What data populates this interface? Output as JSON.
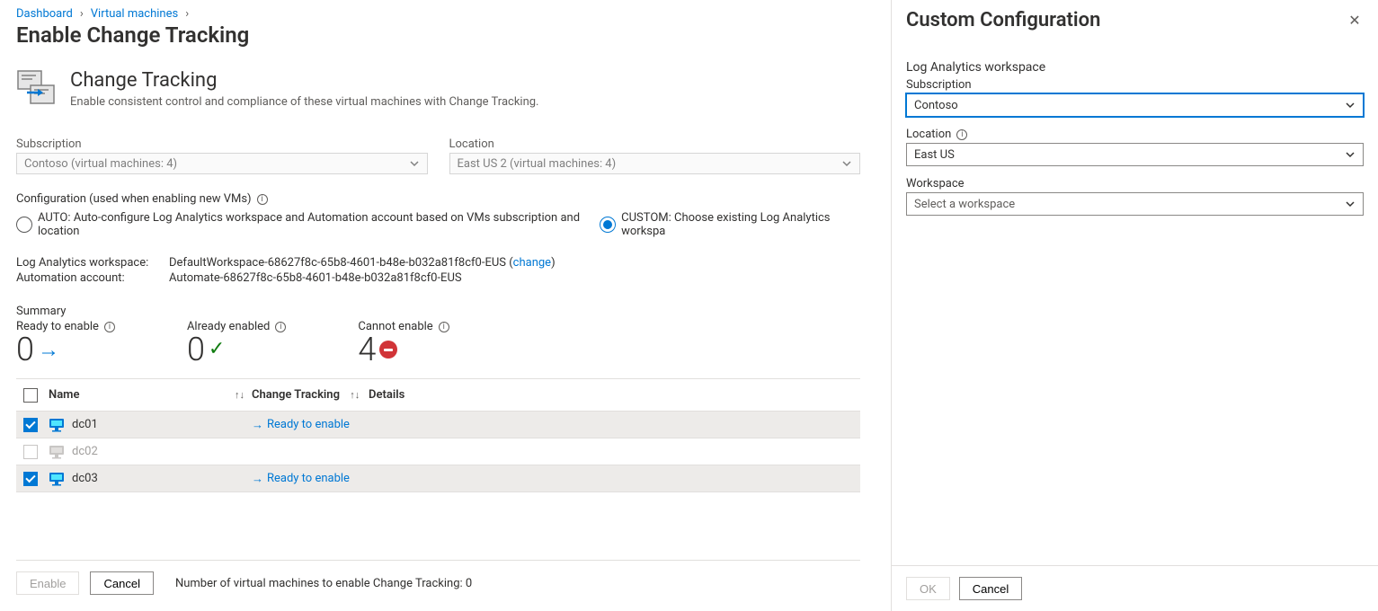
{
  "breadcrumb": {
    "dashboard": "Dashboard",
    "vms": "Virtual machines"
  },
  "page": {
    "title": "Enable Change Tracking"
  },
  "feature": {
    "title": "Change Tracking",
    "desc": "Enable consistent control and compliance of these virtual machines with Change Tracking."
  },
  "filters": {
    "subscription_label": "Subscription",
    "subscription_value": "Contoso (virtual machines: 4)",
    "location_label": "Location",
    "location_value": "East US 2 (virtual machines: 4)"
  },
  "config": {
    "header": "Configuration (used when enabling new VMs)",
    "auto": "AUTO: Auto-configure Log Analytics workspace and Automation account based on VMs subscription and location",
    "custom": "CUSTOM: Choose existing Log Analytics workspa",
    "workspace_label": "Log Analytics workspace:",
    "workspace_value": "DefaultWorkspace-68627f8c-65b8-4601-b48e-b032a81f8cf0-EUS",
    "change_link": "change",
    "automation_label": "Automation account:",
    "automation_value": "Automate-68627f8c-65b8-4601-b48e-b032a81f8cf0-EUS"
  },
  "summary": {
    "title": "Summary",
    "ready_label": "Ready to enable",
    "ready_count": "0",
    "already_label": "Already enabled",
    "already_count": "0",
    "cannot_label": "Cannot enable",
    "cannot_count": "4"
  },
  "table": {
    "col_name": "Name",
    "col_ct": "Change Tracking",
    "col_details": "Details",
    "ready_text": "Ready to enable",
    "rows": [
      {
        "name": "dc01",
        "checked": true,
        "ready": true
      },
      {
        "name": "dc02",
        "checked": false,
        "ready": false
      },
      {
        "name": "dc03",
        "checked": true,
        "ready": true
      }
    ]
  },
  "footer": {
    "enable": "Enable",
    "cancel": "Cancel",
    "count_text": "Number of virtual machines to enable Change Tracking: 0"
  },
  "panel": {
    "title": "Custom Configuration",
    "section": "Log Analytics workspace",
    "sub_label": "Subscription",
    "sub_value": "Contoso",
    "loc_label": "Location",
    "loc_value": "East US",
    "ws_label": "Workspace",
    "ws_placeholder": "Select a workspace",
    "ok": "OK",
    "cancel": "Cancel"
  }
}
